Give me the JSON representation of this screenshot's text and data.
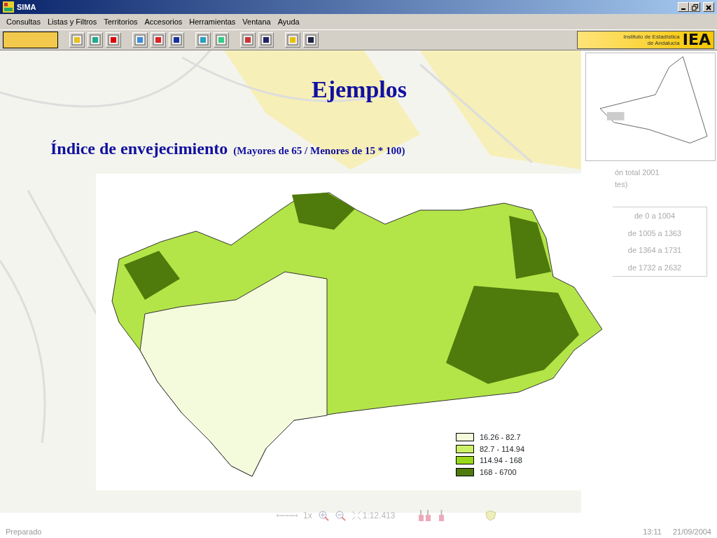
{
  "window": {
    "title": "SIMA"
  },
  "menu": [
    "Consultas",
    "Listas y Filtros",
    "Territorios",
    "Accesorios",
    "Herramientas",
    "Ventana",
    "Ayuda"
  ],
  "logo": {
    "line_1": "Instituto de Estadística",
    "line_2": "de Andalucía",
    "mark": "IEA"
  },
  "slide": {
    "title": "Ejemplos",
    "heading": "Índice de envejecimiento",
    "formula": "(Mayores de 65 / Menores de 15 * 100)"
  },
  "side_panel": {
    "caption_1": "ón total 2001",
    "caption_2": "tes)",
    "legend": [
      "de 0 a 1004",
      "de 1005 a 1363",
      "de 1364 a 1731",
      "de 1732 a 2632"
    ]
  },
  "map_legend": [
    {
      "label": "16.26 - 82.7",
      "color": "#f4fadc"
    },
    {
      "label": "82.7 - 114.94",
      "color": "#cdf069"
    },
    {
      "label": "114.94 - 168",
      "color": "#99d81a"
    },
    {
      "label": "168 - 6700",
      "color": "#4f7a0c"
    }
  ],
  "zoom_bar": {
    "factor": "1x",
    "scale": "1:12.413"
  },
  "status_bar": {
    "text": "Preparado",
    "time": "13:11",
    "date": "21/09/2004"
  }
}
